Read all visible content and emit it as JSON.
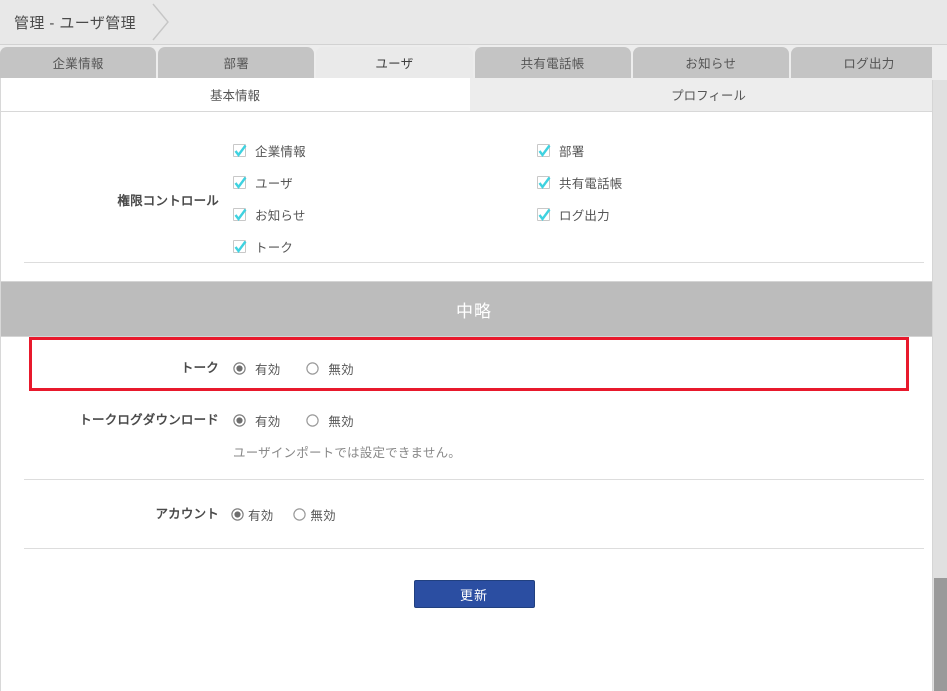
{
  "header": {
    "breadcrumb": "管理 - ユーザ管理"
  },
  "tabs": [
    {
      "label": "企業情報",
      "active": false
    },
    {
      "label": "部署",
      "active": false
    },
    {
      "label": "ユーザ",
      "active": true
    },
    {
      "label": "共有電話帳",
      "active": false
    },
    {
      "label": "お知らせ",
      "active": false
    },
    {
      "label": "ログ出力",
      "active": false
    }
  ],
  "subtabs": [
    {
      "label": "基本情報",
      "active": true
    },
    {
      "label": "プロフィール",
      "active": false
    }
  ],
  "permission_section": {
    "label": "権限コントロール",
    "left_items": [
      {
        "label": "企業情報",
        "checked": true
      },
      {
        "label": "ユーザ",
        "checked": true
      },
      {
        "label": "お知らせ",
        "checked": true
      },
      {
        "label": "トーク",
        "checked": true
      }
    ],
    "right_items": [
      {
        "label": "部署",
        "checked": true
      },
      {
        "label": "共有電話帳",
        "checked": true
      },
      {
        "label": "ログ出力",
        "checked": true
      }
    ]
  },
  "omitted_band": {
    "label": "中略"
  },
  "settings": [
    {
      "label": "トーク",
      "options": [
        {
          "label": "有効",
          "selected": true
        },
        {
          "label": "無効",
          "selected": false
        }
      ],
      "note": "",
      "highlighted": true
    },
    {
      "label": "トークログダウンロード",
      "options": [
        {
          "label": "有効",
          "selected": true
        },
        {
          "label": "無効",
          "selected": false
        }
      ],
      "note": "ユーザインポートでは設定できません。",
      "highlighted": false
    },
    {
      "label": "アカウント",
      "options": [
        {
          "label": "有効",
          "selected": true
        },
        {
          "label": "無効",
          "selected": false
        }
      ],
      "note": "",
      "highlighted": false
    }
  ],
  "footer": {
    "update_label": "更新"
  },
  "colors": {
    "checkbox_accent": "#3fd2e0",
    "highlight_border": "#e8192c",
    "primary_button": "#2b4ea2",
    "band_background": "#bcbcbc"
  }
}
